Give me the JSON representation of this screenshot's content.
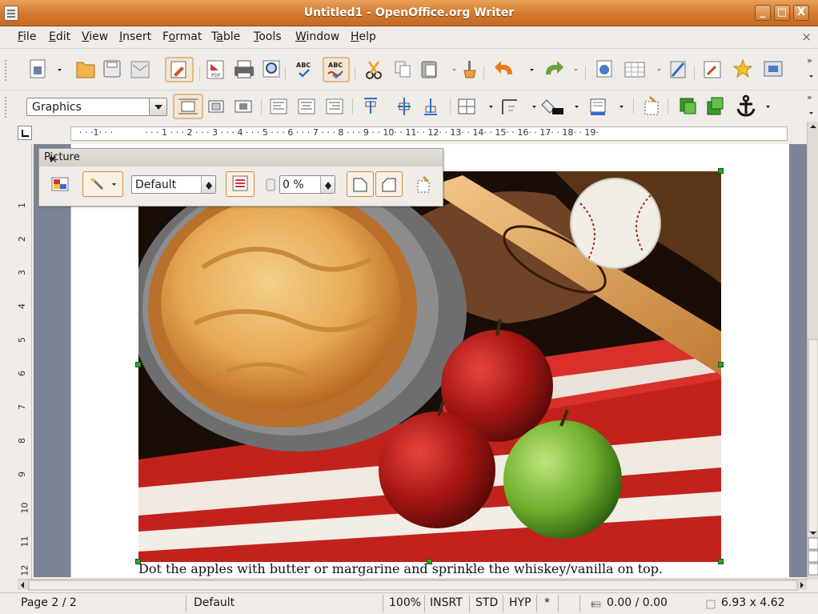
{
  "window": {
    "title": "Untitled1 - OpenOffice.org Writer",
    "minimize": "_",
    "maximize": "□",
    "close": "X"
  },
  "menu": {
    "items": [
      {
        "key": "F",
        "rest": "ile"
      },
      {
        "key": "E",
        "rest": "dit"
      },
      {
        "key": "V",
        "rest": "iew"
      },
      {
        "key": "I",
        "rest": "nsert"
      },
      {
        "pre": "F",
        "key": "o",
        "rest": "rmat"
      },
      {
        "pre": "T",
        "key": "a",
        "rest": "ble"
      },
      {
        "key": "T",
        "rest": "ools"
      },
      {
        "key": "W",
        "rest": "indow"
      },
      {
        "key": "H",
        "rest": "elp"
      }
    ],
    "close_doc": "×"
  },
  "toolbar_format": {
    "style_value": "Graphics"
  },
  "toolbar_standard": {
    "icons": [
      "new-document-icon",
      "open-folder-icon",
      "save-icon",
      "email-icon",
      "edit-mode-icon",
      "export-pdf-icon",
      "print-icon",
      "page-preview-icon",
      "spellcheck-icon",
      "autospellcheck-icon",
      "cut-icon",
      "copy-icon",
      "paste-icon",
      "format-paintbrush-icon",
      "undo-icon",
      "redo-icon",
      "navigator-icon",
      "table-icon",
      "draw-functions-icon",
      "gallery-icon",
      "star-icon",
      "datasource-icon"
    ]
  },
  "ruler": {
    "marks": [
      "1",
      "1",
      "2",
      "3",
      "4",
      "5",
      "6",
      "7",
      "8",
      "9",
      "10",
      "11",
      "12",
      "13",
      "14",
      "15",
      "16",
      "17",
      "18",
      "19"
    ],
    "vmarks": [
      "1",
      "2",
      "3",
      "4",
      "5",
      "6",
      "7",
      "8",
      "9",
      "10",
      "11",
      "12"
    ]
  },
  "picture_toolbar": {
    "title": "Picture",
    "menu_arrow": "▾",
    "close": "×",
    "mode_value": "Default",
    "transparency_value": "0 %"
  },
  "document": {
    "caption": "Dot the apples with butter or margarine and sprinkle the whiskey/vanilla on top.",
    "image_description": "apple-pie-baseball-apples-photo"
  },
  "status": {
    "page": "Page 2 / 2",
    "style": "Default",
    "zoom": "100%",
    "insert_mode": "INSRT",
    "selection_mode": "STD",
    "hyperlink_mode": "HYP",
    "modified": "*",
    "position": "0.00 / 0.00",
    "size": "6.93 x 4.62"
  },
  "colors": {
    "titlebar": "#d2782f",
    "handle": "#2ea52e",
    "accent_orange": "#cc8a48"
  }
}
